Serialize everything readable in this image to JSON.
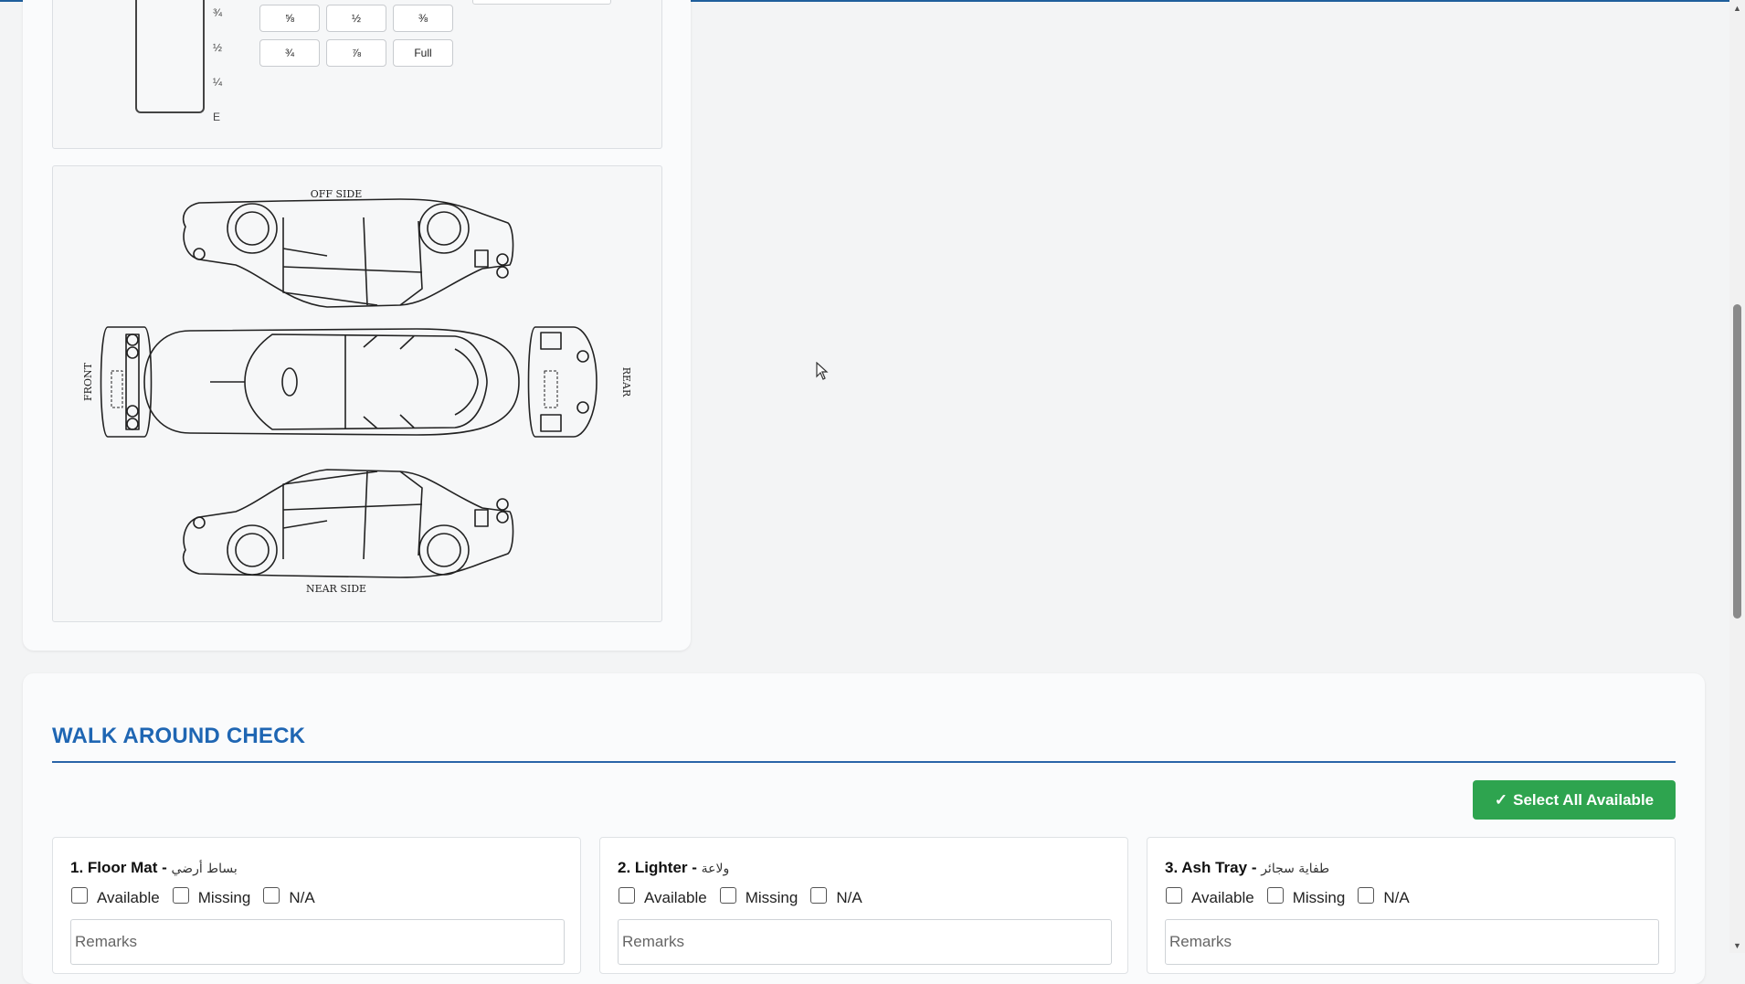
{
  "fuel": {
    "scale": [
      "¾",
      "½",
      "¼",
      "E"
    ],
    "buttons": [
      "⅝",
      "½",
      "⅜",
      "¾",
      "⅞",
      "Full"
    ]
  },
  "diagram": {
    "off_side": "OFF SIDE",
    "near_side": "NEAR SIDE",
    "front": "FRONT",
    "rear": "REAR"
  },
  "walk_around": {
    "title": "WALK AROUND CHECK",
    "select_all": "Select All Available",
    "select_all_icon": "check-icon",
    "options": [
      "Available",
      "Missing",
      "N/A"
    ],
    "remarks_placeholder": "Remarks",
    "items": [
      {
        "label": "1. Floor Mat",
        "sep": " - ",
        "arabic": "بساط أرضي"
      },
      {
        "label": "2. Lighter",
        "sep": " - ",
        "arabic": "ولاعة"
      },
      {
        "label": "3. Ash Tray",
        "sep": " - ",
        "arabic": "طفاية سجائر"
      }
    ]
  },
  "colors": {
    "accent": "#1f66b3",
    "success": "#2ea44f"
  }
}
